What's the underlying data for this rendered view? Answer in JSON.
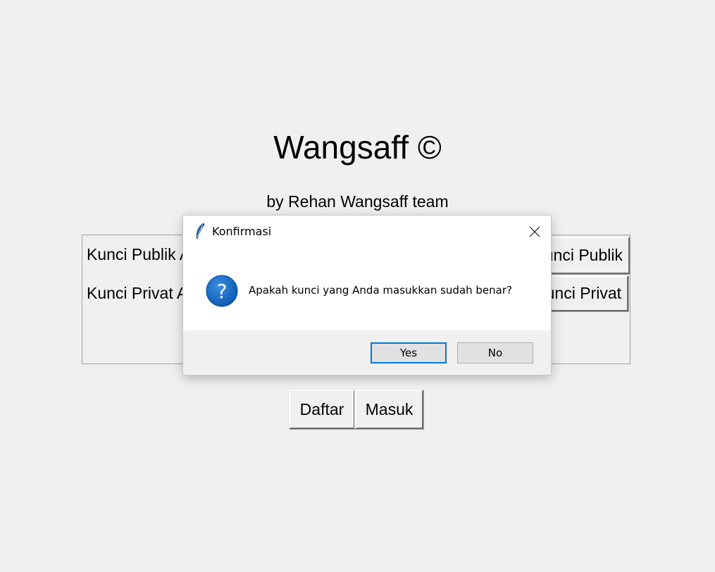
{
  "app": {
    "title": "Wangsaff ©",
    "subtitle": "by Rehan Wangsaff team",
    "labels": {
      "publik": "Kunci Publik Anda",
      "privat": "Kunci Privat Anda"
    },
    "buttons": {
      "publik": "Kunci Publik",
      "privat": "Kunci Privat",
      "daftar": "Daftar",
      "masuk": "Masuk"
    }
  },
  "dialog": {
    "title": "Konfirmasi",
    "message": "Apakah kunci yang Anda masukkan sudah benar?",
    "icon": "question-icon",
    "yes_label": "Yes",
    "no_label": "No",
    "accent": "#0078d7"
  }
}
